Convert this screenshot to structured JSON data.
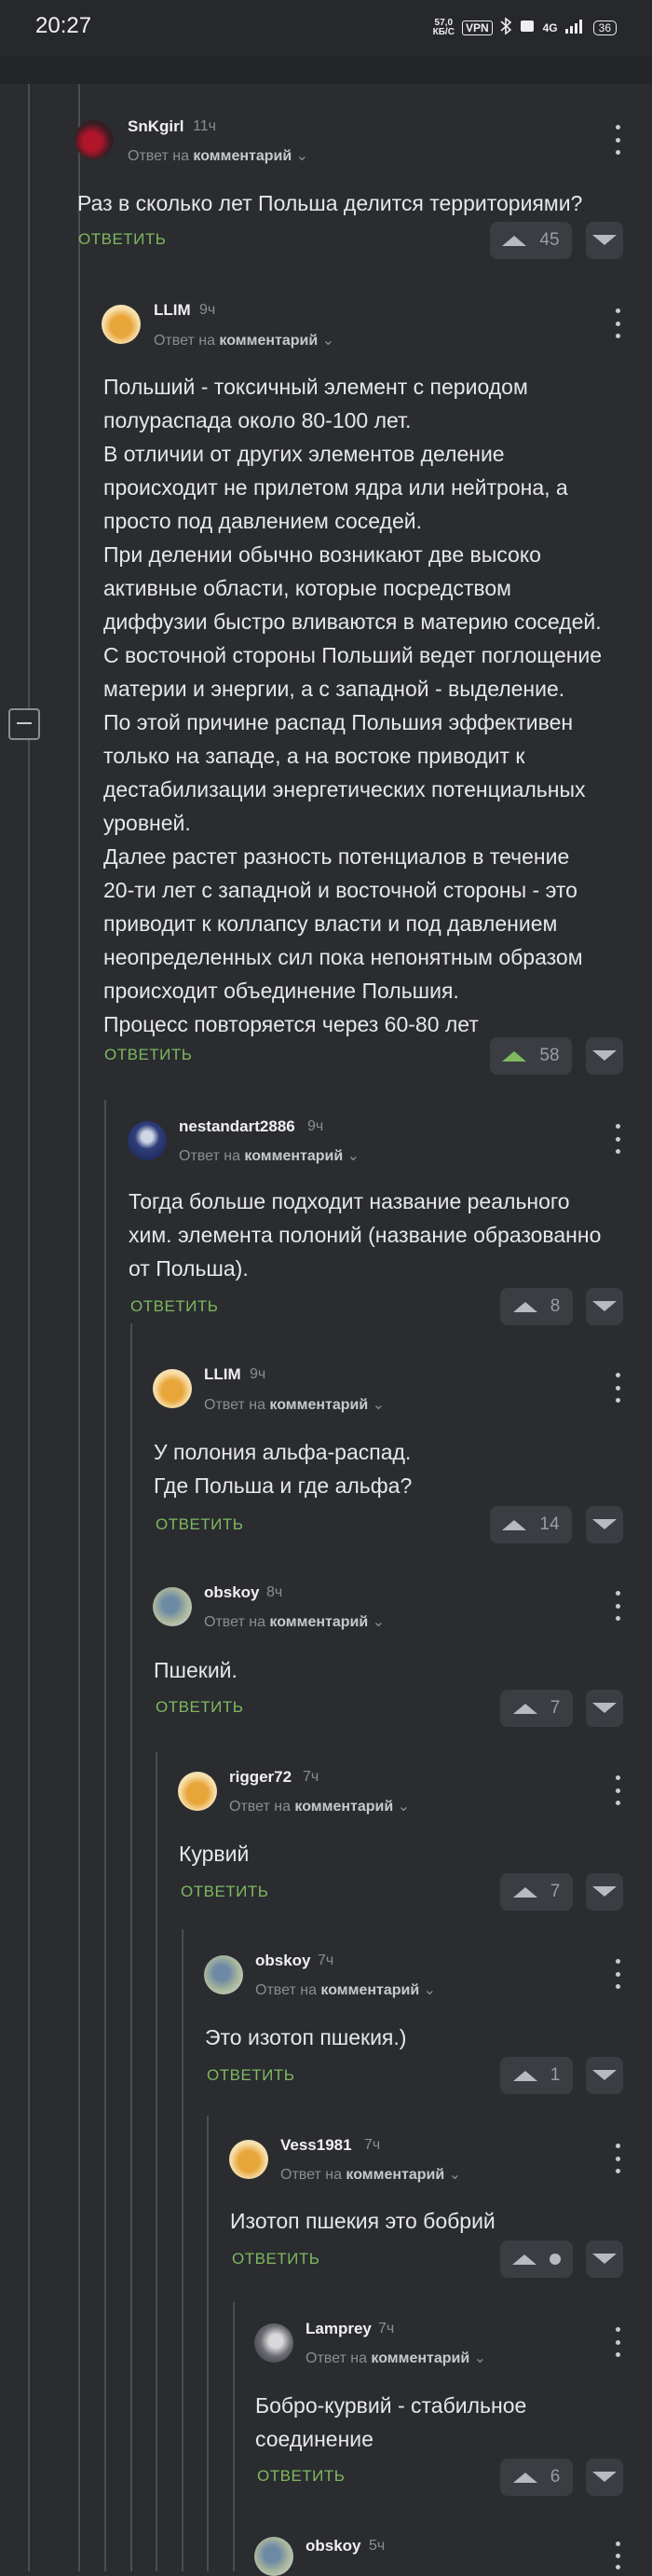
{
  "status_bar": {
    "time": "20:27",
    "speed_value": "57,0",
    "speed_unit": "КБ/С",
    "vpn": "VPN",
    "network": "4G",
    "battery": "36"
  },
  "reply_to_prefix": "Ответ на",
  "reply_to_target": "комментарий",
  "answer_label": "ОТВЕТИТЬ",
  "comments": [
    {
      "author": "SnKgirl",
      "time": "11ч",
      "text": "Раз в сколько лет Польша делится территориями?",
      "rating": "45"
    },
    {
      "author": "LLIM",
      "time": "9ч",
      "text": "Польший - токсичный элемент с периодом\nполураспада около 80-100 лет.\nВ отличии от других элементов деление\nпроисходит не прилетом ядра или нейтрона, а\nпросто под давлением соседей.\nПри делении обычно возникают две высоко\nактивные области, которые посредством\nдиффузии быстро вливаются в материю соседей.\nС восточной стороны Польший ведет поглощение\nматерии и энергии, а с западной - выделение.\nПо этой причине распад Польшия эффективен\nтолько на западе, а на востоке приводит к\nдестабилизации энергетических потенциальных\nуровней.\nДалее растет разность потенциалов в течение\n20-ти лет с западной и восточной стороны - это\nприводит к коллапсу власти и под давлением\nнеопределенных сил пока непонятным образом\nпроисходит объединение Польшия.\nПроцесс повторяется через 60-80 лет",
      "rating": "58"
    },
    {
      "author": "nestandart2886",
      "time": "9ч",
      "text": "Тогда больше подходит название реального\nхим. элемента полоний (название образованно\nот Польша).",
      "rating": "8"
    },
    {
      "author": "LLIM",
      "time": "9ч",
      "text": "У полония альфа-распад.\nГде Польша и где альфа?",
      "rating": "14"
    },
    {
      "author": "obskoy",
      "time": "8ч",
      "text": "Пшекий.",
      "rating": "7"
    },
    {
      "author": "rigger72",
      "time": "7ч",
      "text": "Курвий",
      "rating": "7"
    },
    {
      "author": "obskoy",
      "time": "7ч",
      "text": "Это изотоп пшекия.)",
      "rating": "1"
    },
    {
      "author": "Vess1981",
      "time": "7ч",
      "text": "Изотоп пшекия это бобрий",
      "rating": ""
    },
    {
      "author": "Lamprey",
      "time": "7ч",
      "text": "Бобро-курвий - стабильное\nсоединение",
      "rating": "6"
    },
    {
      "author": "obskoy",
      "time": "5ч",
      "text": "",
      "rating": ""
    }
  ]
}
